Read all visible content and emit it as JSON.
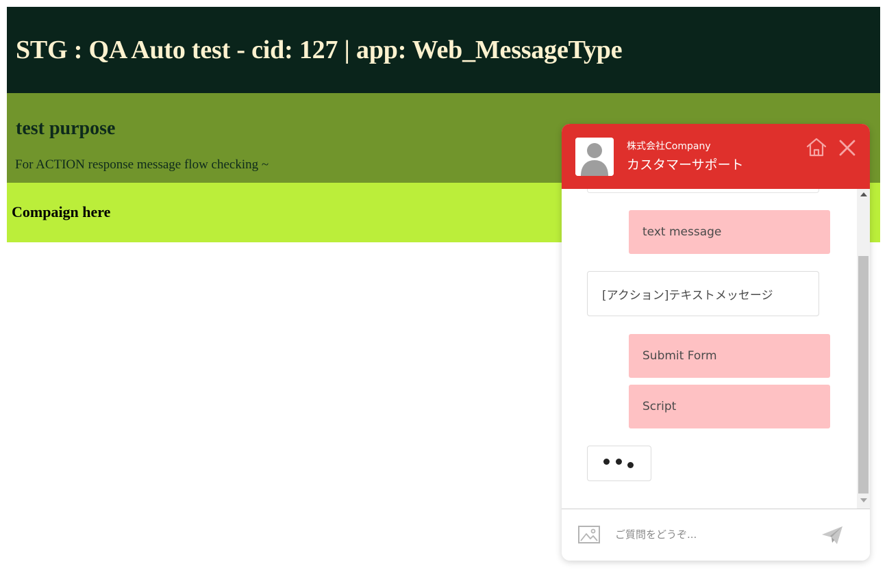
{
  "header": {
    "title": "STG : QA Auto test - cid: 127 | app: Web_MessageType"
  },
  "purpose": {
    "heading": "test purpose",
    "description": "For ACTION response message flow checking ~"
  },
  "campaign": {
    "heading": "Compaign here"
  },
  "chat": {
    "company_name": "株式会社Company",
    "support_title": "カスタマーサポート",
    "accent_color": "#df302c",
    "user_bubble_color": "#fec1c3",
    "icons": {
      "avatar": "person-avatar-icon",
      "home": "home-icon",
      "close": "close-icon",
      "image": "image-icon",
      "send": "send-icon"
    },
    "messages": [
      {
        "sender": "user",
        "text": "text message"
      },
      {
        "sender": "bot",
        "text": "[アクション]テキストメッセージ"
      },
      {
        "sender": "user",
        "text": "Submit Form"
      },
      {
        "sender": "user",
        "text": "Script"
      }
    ],
    "input": {
      "placeholder": "ご質問をどうぞ..."
    }
  }
}
